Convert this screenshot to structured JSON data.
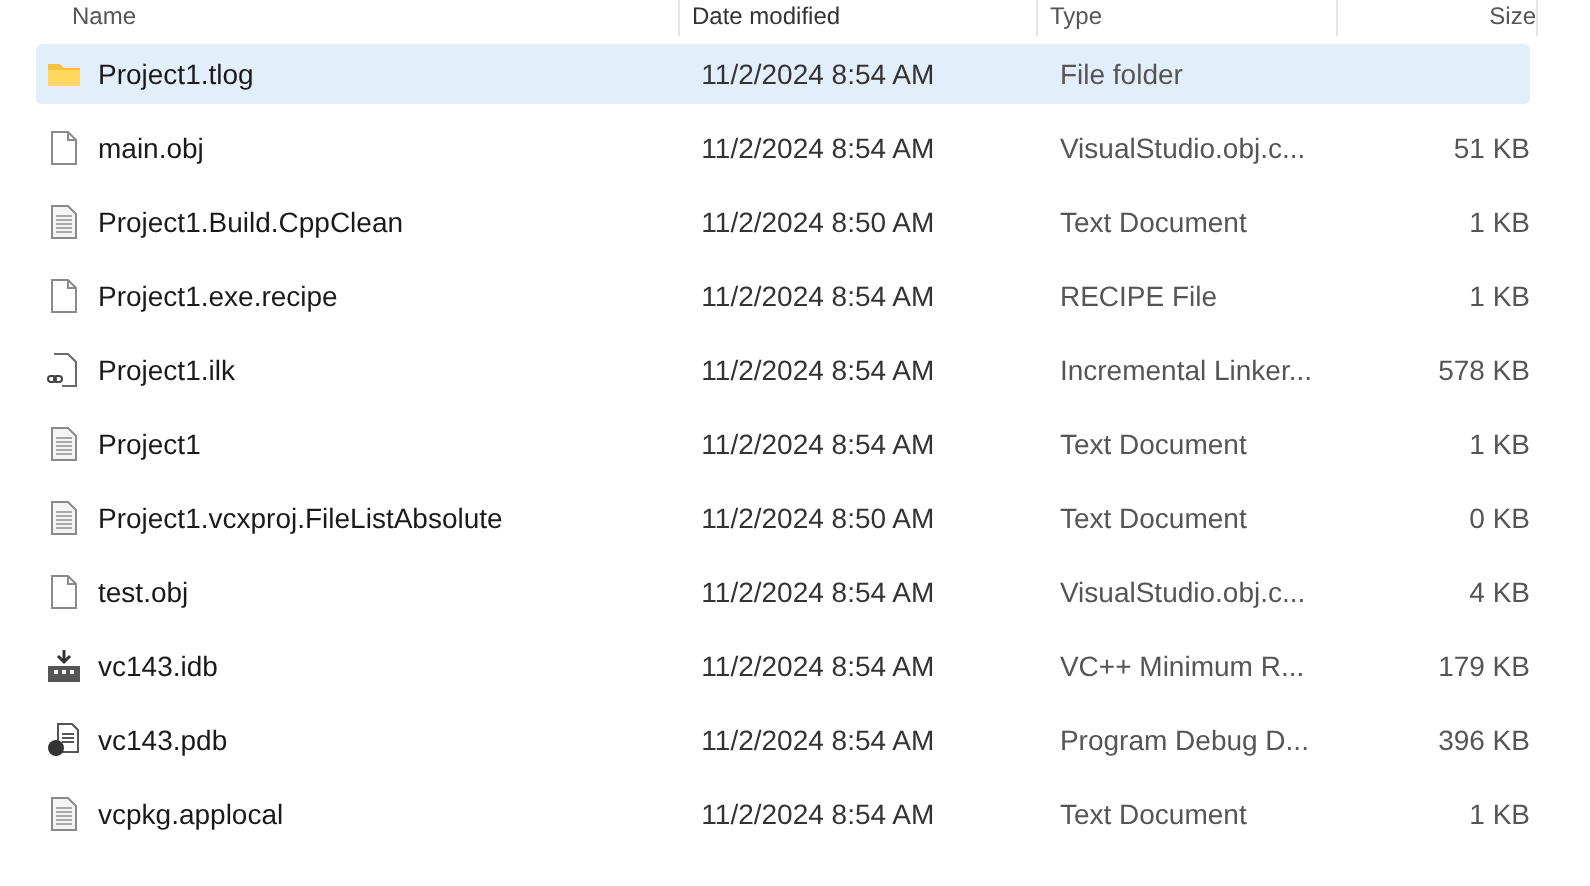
{
  "columns": [
    "Name",
    "Date modified",
    "Type",
    "Size"
  ],
  "rows": [
    {
      "kind": "folder",
      "name": "Project1.tlog",
      "date": "11/2/2024 8:54 AM",
      "type": "File folder",
      "size": "",
      "selected": true
    },
    {
      "kind": "blank",
      "name": "main.obj",
      "date": "11/2/2024 8:54 AM",
      "type": "VisualStudio.obj.c...",
      "size": "51 KB",
      "selected": false
    },
    {
      "kind": "text",
      "name": "Project1.Build.CppClean",
      "date": "11/2/2024 8:50 AM",
      "type": "Text Document",
      "size": "1 KB",
      "selected": false
    },
    {
      "kind": "blank",
      "name": "Project1.exe.recipe",
      "date": "11/2/2024 8:54 AM",
      "type": "RECIPE File",
      "size": "1 KB",
      "selected": false
    },
    {
      "kind": "linker",
      "name": "Project1.ilk",
      "date": "11/2/2024 8:54 AM",
      "type": "Incremental Linker...",
      "size": "578 KB",
      "selected": false
    },
    {
      "kind": "text",
      "name": "Project1",
      "date": "11/2/2024 8:54 AM",
      "type": "Text Document",
      "size": "1 KB",
      "selected": false
    },
    {
      "kind": "text",
      "name": "Project1.vcxproj.FileListAbsolute",
      "date": "11/2/2024 8:50 AM",
      "type": "Text Document",
      "size": "0 KB",
      "selected": false
    },
    {
      "kind": "blank",
      "name": "test.obj",
      "date": "11/2/2024 8:54 AM",
      "type": "VisualStudio.obj.c...",
      "size": "4 KB",
      "selected": false
    },
    {
      "kind": "idb",
      "name": "vc143.idb",
      "date": "11/2/2024 8:54 AM",
      "type": "VC++ Minimum R...",
      "size": "179 KB",
      "selected": false
    },
    {
      "kind": "pdb",
      "name": "vc143.pdb",
      "date": "11/2/2024 8:54 AM",
      "type": "Program Debug D...",
      "size": "396 KB",
      "selected": false
    },
    {
      "kind": "text",
      "name": "vcpkg.applocal",
      "date": "11/2/2024 8:54 AM",
      "type": "Text Document",
      "size": "1 KB",
      "selected": false
    }
  ]
}
